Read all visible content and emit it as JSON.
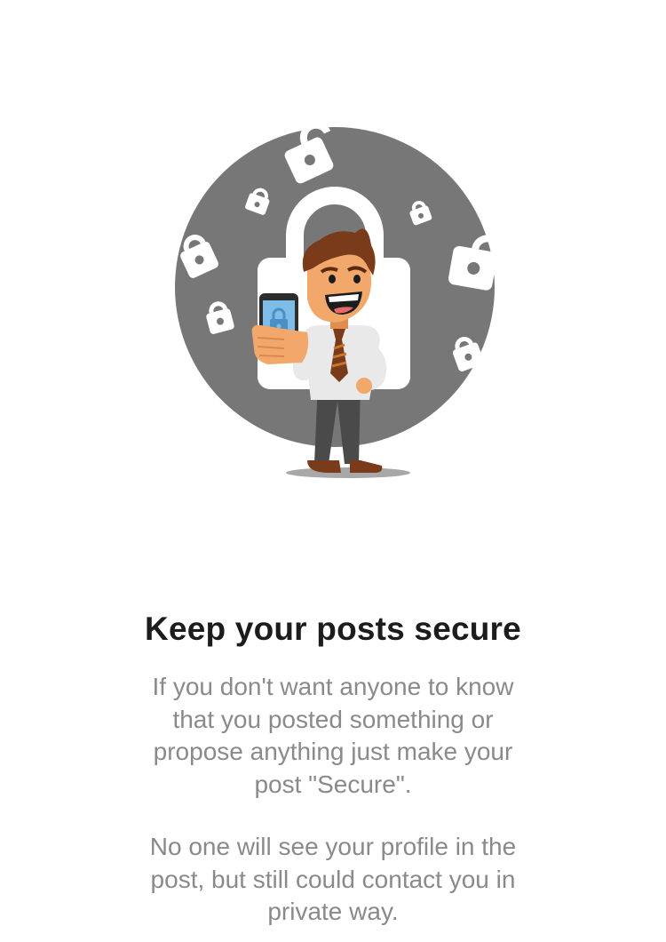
{
  "onboarding": {
    "illustration": {
      "icon": "secure-businessman-with-locks-illustration",
      "circle_color": "#777777",
      "lock_color": "#ffffff"
    },
    "title": "Keep your posts secure",
    "paragraph_1": "If you don't want anyone to know that you posted something or propose anything just make your post \"Secure\".",
    "paragraph_2": "No one will see your profile in the post, but still could contact you in private way."
  }
}
